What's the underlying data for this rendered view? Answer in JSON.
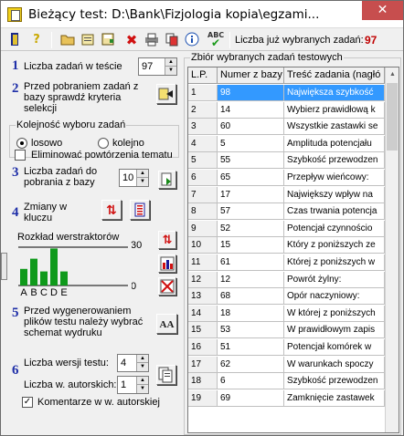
{
  "window": {
    "title": "Bieżący test: D:\\Bank\\Fizjologia kopia\\egzami...",
    "close_glyph": "✕"
  },
  "toolbar": {
    "selected_count_label": "Liczba już wybranych zadań:",
    "selected_count": "97",
    "icons": [
      "exit-door-icon",
      "help-icon",
      "open-folder-icon",
      "open-test-icon",
      "save-test-icon",
      "delete-icon",
      "print-icon",
      "copy-icon",
      "info-icon",
      "spellcheck-icon"
    ]
  },
  "step1": {
    "num": "1",
    "label": "Liczba zadań w teście",
    "value": "97"
  },
  "step2": {
    "num": "2",
    "label": "Przed pobraniem zadań z bazy sprawdź kryteria selekcji"
  },
  "order": {
    "title": "Kolejność wyboru zadań",
    "random": "losowo",
    "sequential": "kolejno",
    "selected": "random"
  },
  "eliminate": {
    "label": "Eliminować powtórzenia tematu",
    "checked": false
  },
  "step3": {
    "num": "3",
    "label": "Liczba zadań do pobrania z bazy",
    "value": "10"
  },
  "step4": {
    "num": "4",
    "label": "Zmiany w kluczu"
  },
  "distribution": {
    "title": "Rozkład werstraktorów",
    "max_label": "30",
    "min_label": "0",
    "letters": [
      "A",
      "B",
      "C",
      "D",
      "E"
    ]
  },
  "chart_data": {
    "type": "bar",
    "title": "Rozkład werstraktorów",
    "categories": [
      "A",
      "B",
      "C",
      "D",
      "E"
    ],
    "values": [
      13,
      21,
      11,
      29,
      11
    ],
    "ylim": [
      0,
      30
    ]
  },
  "step5": {
    "num": "5",
    "label": "Przed wygenerowaniem plików testu należy wybrać schemat wydruku"
  },
  "step6": {
    "num": "6",
    "versions_label": "Liczba wersji testu:",
    "versions_value": "4",
    "author_label": "Liczba w. autorskich:",
    "author_value": "1",
    "comments_label": "Komentarze w w. autorskiej",
    "comments_checked": true
  },
  "table": {
    "title": "Zbiór wybranych zadań testowych",
    "headers": [
      "L.P.",
      "Numer z bazy",
      "Treść zadania (nagłó"
    ],
    "rows": [
      [
        "1",
        "98",
        "Największa szybkość"
      ],
      [
        "2",
        "14",
        "Wybierz prawidłową k"
      ],
      [
        "3",
        "60",
        "Wszystkie zastawki se"
      ],
      [
        "4",
        "5",
        "Amplituda potencjału"
      ],
      [
        "5",
        "55",
        "Szybkość przewodzen"
      ],
      [
        "6",
        "65",
        "Przepływ wieńcowy:"
      ],
      [
        "7",
        "17",
        "Największy wpływ na"
      ],
      [
        "8",
        "57",
        "Czas trwania potencja"
      ],
      [
        "9",
        "52",
        "Potencjał czynnościo"
      ],
      [
        "10",
        "15",
        "Który z poniższych ze"
      ],
      [
        "11",
        "61",
        "Której z poniższych w"
      ],
      [
        "12",
        "12",
        "Powrót żylny:"
      ],
      [
        "13",
        "68",
        "Opór naczyniowy:"
      ],
      [
        "14",
        "18",
        "W której z poniższych"
      ],
      [
        "15",
        "53",
        "W prawidłowym zapis"
      ],
      [
        "16",
        "51",
        "Potencjał  komórek w"
      ],
      [
        "17",
        "62",
        "W warunkach spoczy"
      ],
      [
        "18",
        "6",
        "Szybkość przewodzen"
      ],
      [
        "19",
        "69",
        "Zamknięcie zastawek"
      ]
    ],
    "selected_row": 0
  }
}
